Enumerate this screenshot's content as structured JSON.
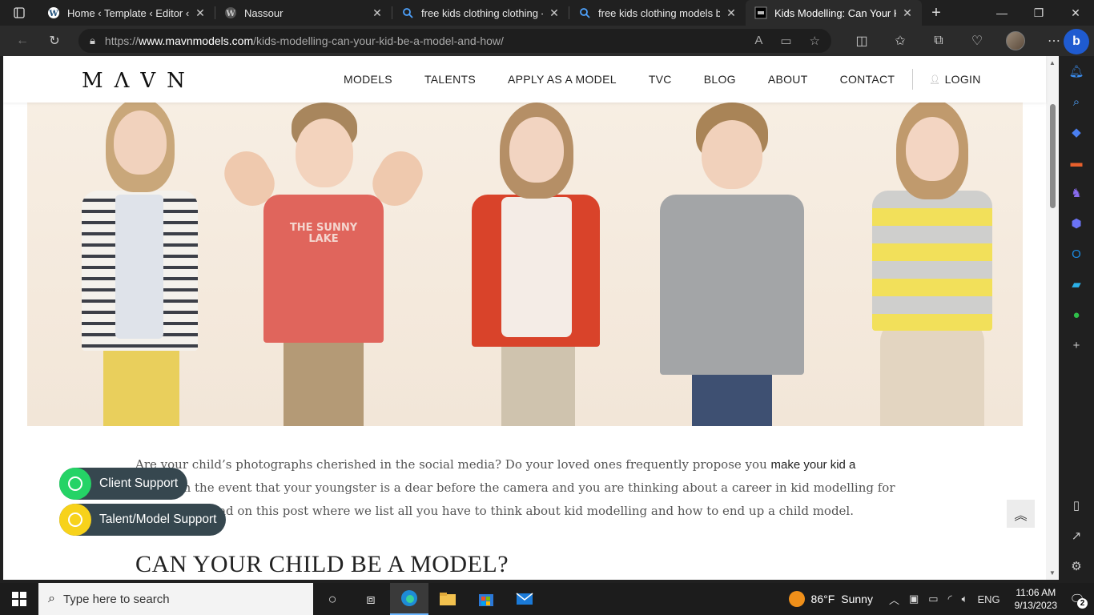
{
  "browser": {
    "tabs": [
      {
        "title": "Home ‹ Template ‹ Editor ‹ Na",
        "icon": "wordpress-icon",
        "active": false
      },
      {
        "title": "Nassour",
        "icon": "wordpress-icon",
        "active": false
      },
      {
        "title": "free kids clothing clothing - S",
        "icon": "search-icon",
        "active": false
      },
      {
        "title": "free kids clothing models boy",
        "icon": "search-icon",
        "active": false
      },
      {
        "title": "Kids Modelling: Can Your Kid",
        "icon": "mavn-icon",
        "active": true
      }
    ],
    "address": {
      "prefix": "https://",
      "host": "www.mavnmodels.com",
      "path": "/kids-modelling-can-your-kid-be-a-model-and-how/"
    }
  },
  "site": {
    "logo": "MΛVN",
    "nav": [
      "MODELS",
      "TALENTS",
      "APPLY AS A MODEL",
      "TVC",
      "BLOG",
      "ABOUT",
      "CONTACT"
    ],
    "login": "LOGIN",
    "hero_shirt_text": "THE SUNNY LAKE"
  },
  "article": {
    "p1_a": "Are your child’s photographs cherished in the social media? Do your loved ones frequently propose you ",
    "p1_link": "make your kid a model",
    "p1_b": "? In the event that your youngster is a dear before the camera and you are thinking about a career in kid modelling for him or her, read on this post where we list all you have to think about kid modelling and how to end up a child model.",
    "heading": "CAN YOUR CHILD BE A MODEL?"
  },
  "support": {
    "client": "Client Support",
    "talent": "Talent/Model Support",
    "client_color": "#25d366",
    "talent_color": "#f7d21b"
  },
  "taskbar": {
    "search_placeholder": "Type here to search",
    "weather_temp": "86°F",
    "weather_desc": "Sunny",
    "lang": "ENG",
    "time": "11:06 AM",
    "date": "9/13/2023",
    "notifications": "2"
  }
}
